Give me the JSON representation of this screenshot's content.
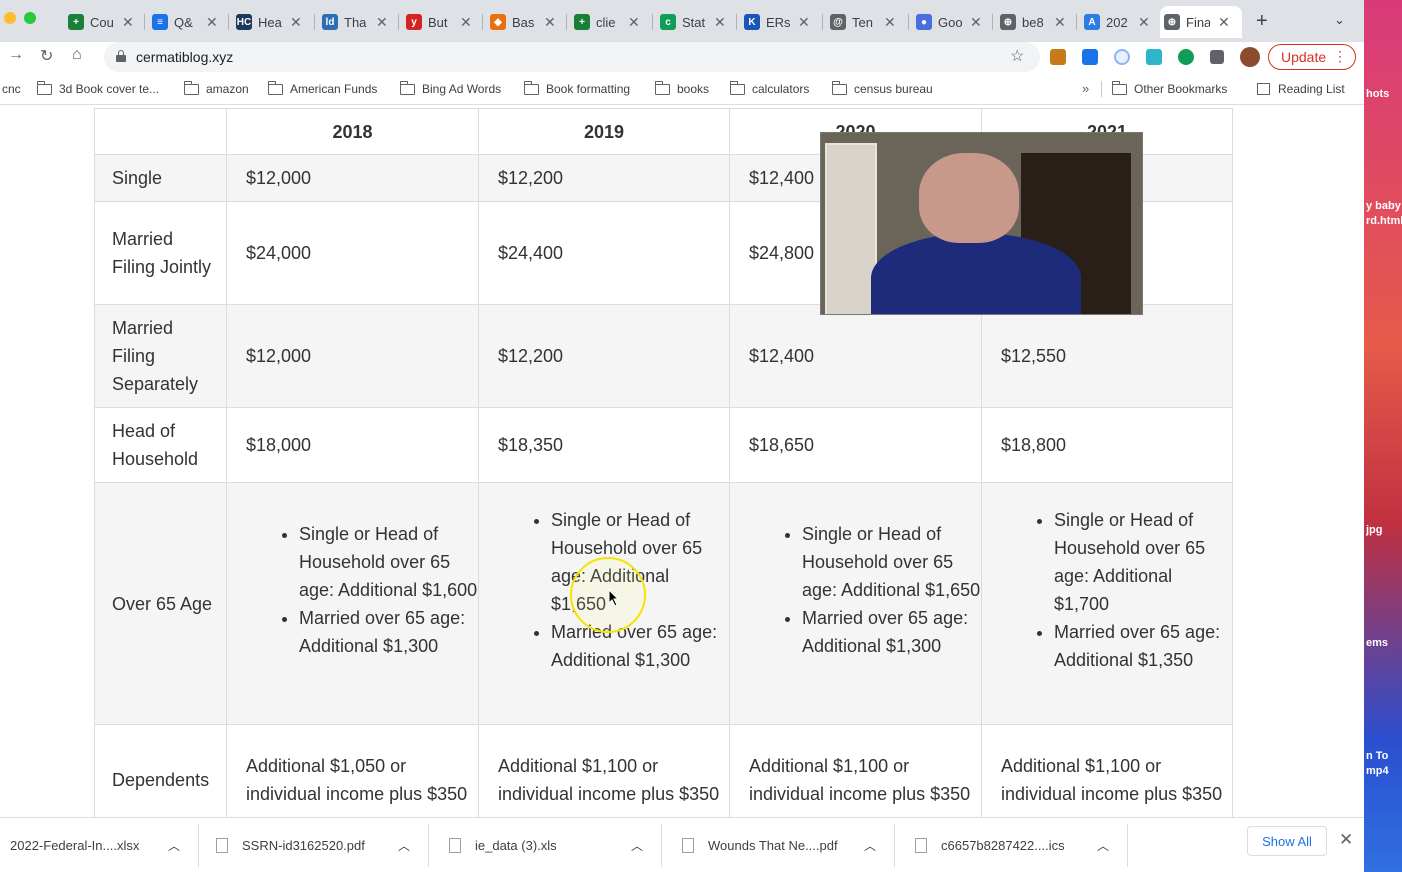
{
  "tabs": [
    {
      "title": "Cou",
      "icon": "google-sheets-icon",
      "color": "#188038",
      "glyph": "+"
    },
    {
      "title": "Q&",
      "icon": "google-docs-icon",
      "color": "#1a73e8",
      "glyph": "≡"
    },
    {
      "title": "Hea",
      "icon": "hc-icon",
      "color": "#1b3a5c",
      "glyph": "HC"
    },
    {
      "title": "Tha",
      "icon": "chart-site-icon",
      "color": "#2d6db5",
      "glyph": "ld"
    },
    {
      "title": "But",
      "icon": "yelp-icon",
      "color": "#d32323",
      "glyph": "y"
    },
    {
      "title": "Bas",
      "icon": "diamond-icon",
      "color": "#e8710a",
      "glyph": "◆"
    },
    {
      "title": "clie",
      "icon": "google-sheets-icon",
      "color": "#188038",
      "glyph": "+"
    },
    {
      "title": "Stat",
      "icon": "c-icon",
      "color": "#0f9d58",
      "glyph": "c"
    },
    {
      "title": "ERs",
      "icon": "k-icon",
      "color": "#1a56b8",
      "glyph": "K"
    },
    {
      "title": "Ten",
      "icon": "search-circle-icon",
      "color": "#5f6368",
      "glyph": "@"
    },
    {
      "title": "Goo",
      "icon": "globe-blue-icon",
      "color": "#4a6ee0",
      "glyph": "●"
    },
    {
      "title": "be8",
      "icon": "globe-icon",
      "color": "#5f6368",
      "glyph": "⊕"
    },
    {
      "title": "202",
      "icon": "a-icon",
      "color": "#2a7de1",
      "glyph": "A"
    },
    {
      "title": "Fina",
      "icon": "globe-icon",
      "color": "#5f6368",
      "glyph": "⊕"
    }
  ],
  "toolbar": {
    "url": "cermatiblog.xyz",
    "update_label": "Update"
  },
  "bookmarks": [
    {
      "label": "cnc",
      "folder": false
    },
    {
      "label": "3d Book cover te...",
      "folder": true
    },
    {
      "label": "amazon",
      "folder": true
    },
    {
      "label": "American Funds",
      "folder": true
    },
    {
      "label": "Bing Ad Words",
      "folder": true
    },
    {
      "label": "Book formatting",
      "folder": true
    },
    {
      "label": "books",
      "folder": true
    },
    {
      "label": "calculators",
      "folder": true
    },
    {
      "label": "census bureau",
      "folder": true
    }
  ],
  "bookmarks_right": {
    "chevron": "»",
    "other": "Other Bookmarks",
    "reading_list": "Reading List"
  },
  "table": {
    "headers": [
      "",
      "2018",
      "2019",
      "2020",
      "2021"
    ],
    "rows": [
      {
        "label": "Single",
        "values": [
          "$12,000",
          "$12,200",
          "$12,400",
          ""
        ]
      },
      {
        "label": "Married Filing Jointly",
        "values": [
          "$24,000",
          "$24,400",
          "$24,800",
          ""
        ]
      },
      {
        "label": "Married Filing Separately",
        "values": [
          "$12,000",
          "$12,200",
          "$12,400",
          "$12,550"
        ]
      },
      {
        "label": "Head of Household",
        "values": [
          "$18,000",
          "$18,350",
          "$18,650",
          "$18,800"
        ]
      }
    ],
    "over65": {
      "label": "Over 65 Age",
      "cells": [
        [
          "Single or Head of Household over 65 age: Additional $1,600",
          "Married over 65 age: Additional $1,300"
        ],
        [
          "Single or Head of Household over 65 age: Additional $1,650",
          "Married over 65 age: Additional $1,300"
        ],
        [
          "Single or Head of Household over 65 age: Additional $1,650",
          "Married over 65 age: Additional $1,300"
        ],
        [
          "Single or Head of Household over 65 age: Additional $1,700",
          "Married over 65 age: Additional $1,350"
        ]
      ]
    },
    "dependents": {
      "label": "Dependents",
      "values": [
        "Additional $1,050 or individual income plus $350",
        "Additional $1,100 or individual income plus $350",
        "Additional $1,100 or individual income plus $350",
        "Additional $1,100 or individual income plus $350"
      ]
    }
  },
  "downloads": {
    "items": [
      "2022-Federal-In....xlsx",
      "SSRN-id3162520.pdf",
      "ie_data (3).xls",
      "Wounds That Ne....pdf",
      "c6657b8287422....ics"
    ],
    "show_all": "Show All"
  },
  "desktop": {
    "labels": [
      "hots",
      "y baby",
      "rd.html",
      "jpg",
      "ems",
      "n To",
      "mp4"
    ]
  }
}
